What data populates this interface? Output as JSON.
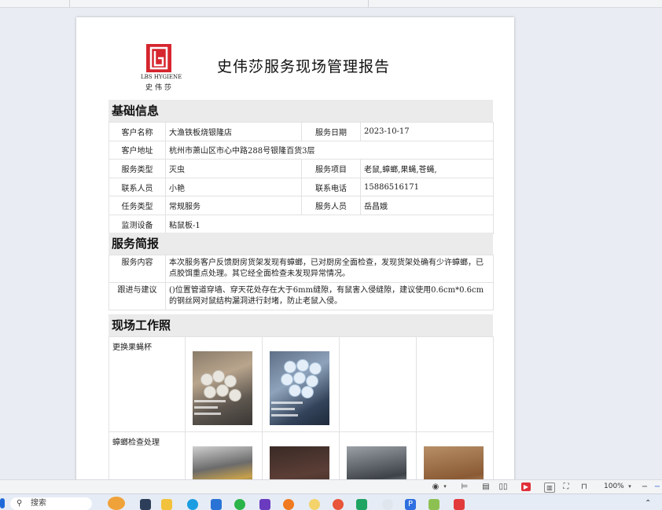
{
  "report": {
    "title": "史伟莎服务现场管理报告",
    "logo_brand": "LBS HYGIENE",
    "logo_cn": "史伟莎"
  },
  "basic": {
    "heading": "基础信息",
    "customer_name_label": "客户名称",
    "customer_name": "大渔铁板烧银隆店",
    "service_date_label": "服务日期",
    "service_date": "2023-10-17",
    "customer_address_label": "客户地址",
    "customer_address": "杭州市萧山区市心中路288号银隆百货3层",
    "service_type_label": "服务类型",
    "service_type": "灭虫",
    "service_items_label": "服务项目",
    "service_items": "老鼠,蟑螂,果蝇,苍蝇,",
    "contact_label": "联系人员",
    "contact": "小艳",
    "phone_label": "联系电话",
    "phone": "15886516171",
    "task_type_label": "任务类型",
    "task_type": "常规服务",
    "staff_label": "服务人员",
    "staff": "岳昌娥",
    "equipment_label": "监测设备",
    "equipment": "粘鼠板-1"
  },
  "brief": {
    "heading": "服务简报",
    "content_label": "服务内容",
    "content": "本次服务客户反馈厨房货架发现有蟑螂，已对厨房全面检查，发现货架处确有少许蟑螂，已点胶饵重点处理。其它经全面检查未发现异常情况。",
    "advice_label": "跟进与建议",
    "advice": "()位置管道穿墙、穿天花处存在大于6mm缝隙，有鼠害入侵缝隙，建议使用0.6cm*0.6cm的钢丝网对鼠结构漏洞进行封堵，防止老鼠入侵。"
  },
  "photos": {
    "heading": "现场工作照",
    "row1_label": "更换果蝇杯",
    "row2_label": "蟑螂检查处理"
  },
  "statusbar": {
    "zoom": "100%"
  },
  "taskbar": {
    "search_label": "搜索"
  }
}
